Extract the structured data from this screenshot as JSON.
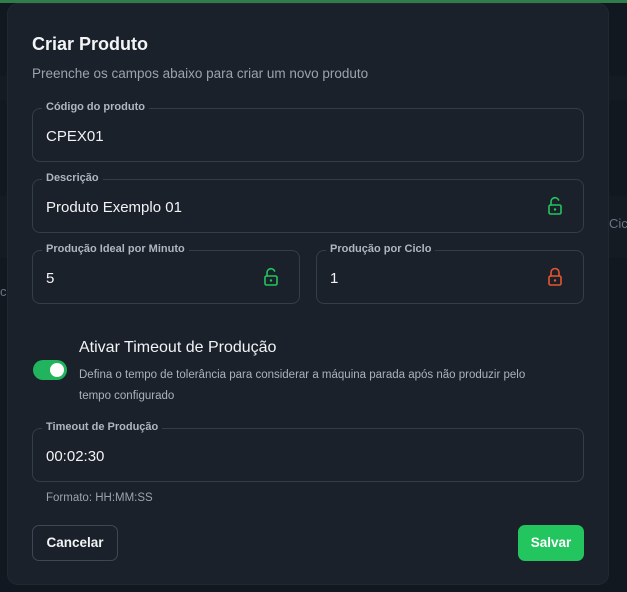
{
  "background": {
    "text_left": "ca",
    "text_right": "Cic"
  },
  "dialog": {
    "title": "Criar Produto",
    "subtitle": "Preenche os campos abaixo para criar um novo produto",
    "fields": {
      "codigo": {
        "label": "Código do produto",
        "value": "CPEX01"
      },
      "descricao": {
        "label": "Descrição",
        "value": "Produto Exemplo 01",
        "lock": "open"
      },
      "producao_ideal": {
        "label": "Produção Ideal por Minuto",
        "value": "5",
        "lock": "open"
      },
      "producao_ciclo": {
        "label": "Produção por Ciclo",
        "value": "1",
        "lock": "closed"
      }
    },
    "timeout_toggle": {
      "enabled": true,
      "title": "Ativar Timeout de Produção",
      "description": "Defina o tempo de tolerância para considerar a máquina parada após não produzir pelo tempo configurado"
    },
    "timeout_field": {
      "label": "Timeout de Produção",
      "value": "00:02:30"
    },
    "format_hint": "Formato: HH:MM:SS",
    "buttons": {
      "cancel": "Cancelar",
      "save": "Salvar"
    }
  },
  "colors": {
    "accent_green": "#22c55e",
    "lock_open": "#22c55e",
    "lock_closed": "#e8552f",
    "modal_bg": "#1a212a",
    "page_bg": "#111820"
  }
}
